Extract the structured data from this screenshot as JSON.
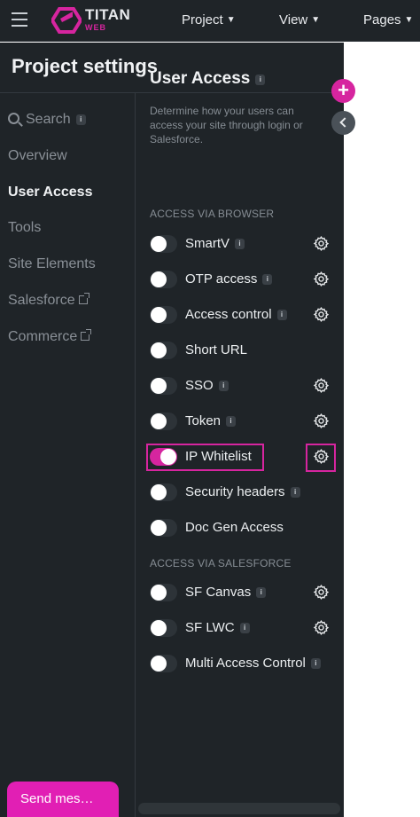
{
  "topbar": {
    "brand": "TITAN",
    "brand_sub": "WEB",
    "nav": [
      {
        "label": "Project"
      },
      {
        "label": "View"
      },
      {
        "label": "Pages"
      }
    ]
  },
  "panel": {
    "title": "Project settings",
    "sidenav": {
      "search": "Search",
      "items": [
        "Overview",
        "User Access",
        "Tools",
        "Site Elements",
        "Salesforce",
        "Commerce"
      ]
    }
  },
  "user_access": {
    "title": "User Access",
    "description": "Determine how your users can access your site through login or Salesforce.",
    "browser_section": "ACCESS VIA BROWSER",
    "browser_items": [
      {
        "label": "SmartV",
        "info": true,
        "gear": true,
        "enabled": false
      },
      {
        "label": "OTP access",
        "info": true,
        "gear": true,
        "enabled": false
      },
      {
        "label": "Access control",
        "info": true,
        "gear": true,
        "enabled": false
      },
      {
        "label": "Short URL",
        "info": false,
        "gear": false,
        "enabled": false
      },
      {
        "label": "SSO",
        "info": true,
        "gear": true,
        "enabled": false
      },
      {
        "label": "Token",
        "info": true,
        "gear": true,
        "enabled": false
      },
      {
        "label": "IP Whitelist",
        "info": false,
        "gear": true,
        "enabled": true
      },
      {
        "label": "Security headers",
        "info": true,
        "gear": false,
        "enabled": false
      },
      {
        "label": "Doc Gen Access",
        "info": false,
        "gear": false,
        "enabled": false
      }
    ],
    "salesforce_section": "ACCESS VIA SALESFORCE",
    "salesforce_items": [
      {
        "label": "SF Canvas",
        "info": true,
        "gear": true,
        "enabled": false
      },
      {
        "label": "SF LWC",
        "info": true,
        "gear": true,
        "enabled": false
      },
      {
        "label": "Multi Access Control",
        "info": true,
        "gear": false,
        "enabled": false
      }
    ],
    "info_glyph": "i"
  },
  "fab": {
    "add": "+"
  },
  "chat": {
    "send_label": "Send mes…"
  },
  "colors": {
    "accent": "#d6259f",
    "panel_bg": "#1f2428",
    "send_button": "#e11fb4"
  }
}
